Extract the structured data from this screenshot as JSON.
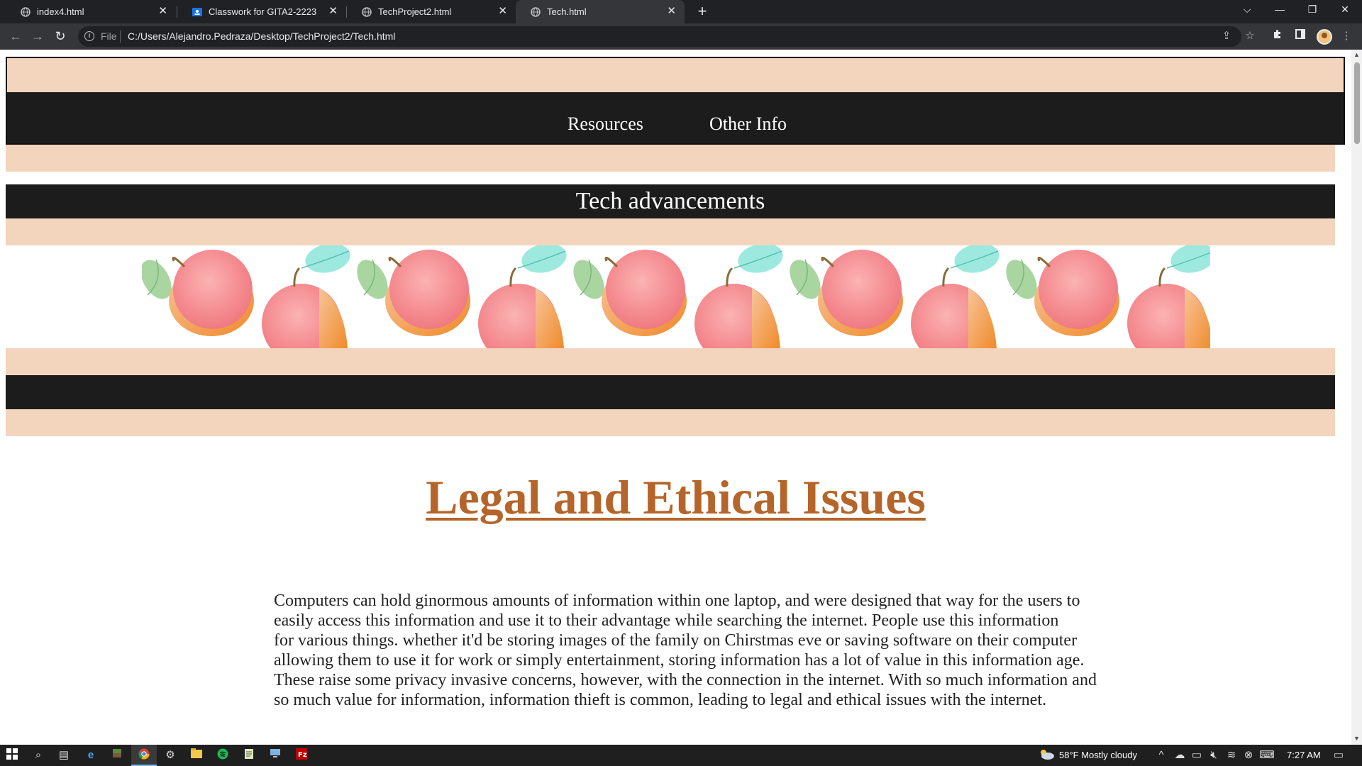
{
  "browser": {
    "tabs": [
      {
        "title": "index4.html",
        "icon": "globe-icon"
      },
      {
        "title": "Classwork for GITA2-2223",
        "icon": "classroom-icon"
      },
      {
        "title": "TechProject2.html",
        "icon": "globe-icon"
      },
      {
        "title": "Tech.html",
        "icon": "globe-icon",
        "active": true
      }
    ],
    "omnibox": {
      "scheme_label": "File",
      "url": "C:/Users/Alejandro.Pedraza/Desktop/TechProject2/Tech.html"
    }
  },
  "page": {
    "nav": {
      "links": [
        "Resources",
        "Other Info"
      ]
    },
    "hero_title": "Tech advancements",
    "section_heading": "Legal and Ethical Issues",
    "paragraph_lines": [
      "Computers can hold ginormous amounts of information within one laptop, and were designed that way for the users to",
      "easily access this information and use it to their advantage while searching the internet. People use this information",
      "for various things. whether it'd be storing images of the family on Chirstmas eve or saving software on their computer",
      "allowing them to use it for work or simply entertainment, storing information has a lot of value in this information age.",
      "These raise some privacy invasive concerns, however, with the connection in the internet. With so much information and",
      "so much value for information, information thieft is common, leading to legal and ethical issues with the internet."
    ],
    "colors": {
      "peach": "#f3d5bd",
      "dark": "#1c1c1c",
      "heading": "#b5652a"
    }
  },
  "taskbar": {
    "weather": "58°F  Mostly cloudy",
    "time": "7:27 AM"
  }
}
